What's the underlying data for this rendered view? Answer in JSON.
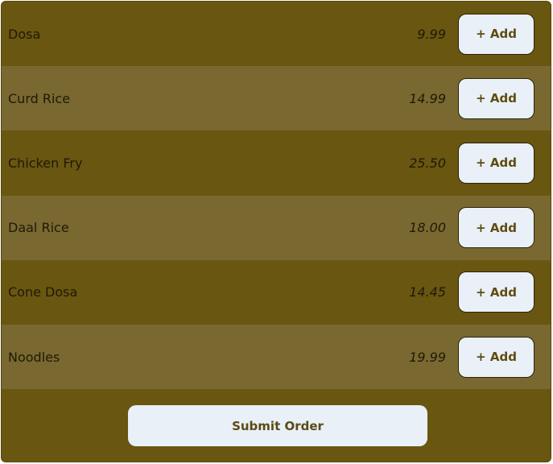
{
  "menu": {
    "items": [
      {
        "name": "Dosa",
        "price": "9.99",
        "add_label": "+ Add"
      },
      {
        "name": "Curd Rice",
        "price": "14.99",
        "add_label": "+ Add"
      },
      {
        "name": "Chicken Fry",
        "price": "25.50",
        "add_label": "+ Add"
      },
      {
        "name": "Daal Rice",
        "price": "18.00",
        "add_label": "+ Add"
      },
      {
        "name": "Cone Dosa",
        "price": "14.45",
        "add_label": "+ Add"
      },
      {
        "name": "Noodles",
        "price": "19.99",
        "add_label": "+ Add"
      }
    ],
    "submit_label": "Submit Order"
  },
  "colors": {
    "card_bg": "#695610",
    "row_alt_bg": "#796830",
    "button_bg": "#e9f0f7",
    "button_text": "#5e4c10",
    "text": "#1f1a06"
  }
}
